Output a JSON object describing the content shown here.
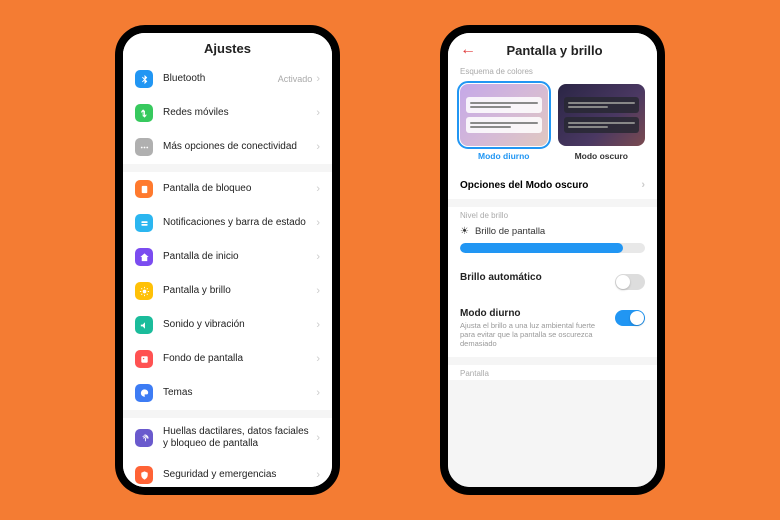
{
  "left": {
    "title": "Ajustes",
    "groups": [
      [
        {
          "icon": "bluetooth-icon",
          "color": "i-blue",
          "label": "Bluetooth",
          "status": "Activado"
        },
        {
          "icon": "mobile-data-icon",
          "color": "i-green",
          "label": "Redes móviles"
        },
        {
          "icon": "more-icon",
          "color": "i-gray",
          "label": "Más opciones de conectividad"
        }
      ],
      [
        {
          "icon": "lock-screen-icon",
          "color": "i-orange",
          "label": "Pantalla de bloqueo"
        },
        {
          "icon": "notifications-icon",
          "color": "i-cyan",
          "label": "Notificaciones y barra de estado"
        },
        {
          "icon": "home-icon",
          "color": "i-purple",
          "label": "Pantalla de inicio"
        },
        {
          "icon": "brightness-icon",
          "color": "i-yellow",
          "label": "Pantalla y brillo"
        },
        {
          "icon": "sound-icon",
          "color": "i-teal",
          "label": "Sonido y vibración"
        },
        {
          "icon": "wallpaper-icon",
          "color": "i-red",
          "label": "Fondo de pantalla"
        },
        {
          "icon": "themes-icon",
          "color": "i-blue2",
          "label": "Temas"
        }
      ],
      [
        {
          "icon": "fingerprint-icon",
          "color": "i-deeppurple",
          "label": "Huellas dactilares, datos faciales y bloqueo de pantalla"
        },
        {
          "icon": "security-icon",
          "color": "i-redorange",
          "label": "Seguridad y emergencias"
        }
      ]
    ]
  },
  "right": {
    "title": "Pantalla y brillo",
    "scheme_header": "Esquema de colores",
    "schemes": [
      {
        "label": "Modo diurno",
        "selected": true
      },
      {
        "label": "Modo oscuro",
        "selected": false
      }
    ],
    "dark_options": "Opciones del Modo oscuro",
    "brightness_header": "Nivel de brillo",
    "brightness_label": "Brillo de pantalla",
    "brightness_percent": 88,
    "auto_brightness": {
      "title": "Brillo automático",
      "on": false
    },
    "day_mode": {
      "title": "Modo diurno",
      "desc": "Ajusta el brillo a una luz ambiental fuerte para evitar que la pantalla se oscurezca demasiado",
      "on": true
    },
    "footer": "Pantalla"
  }
}
